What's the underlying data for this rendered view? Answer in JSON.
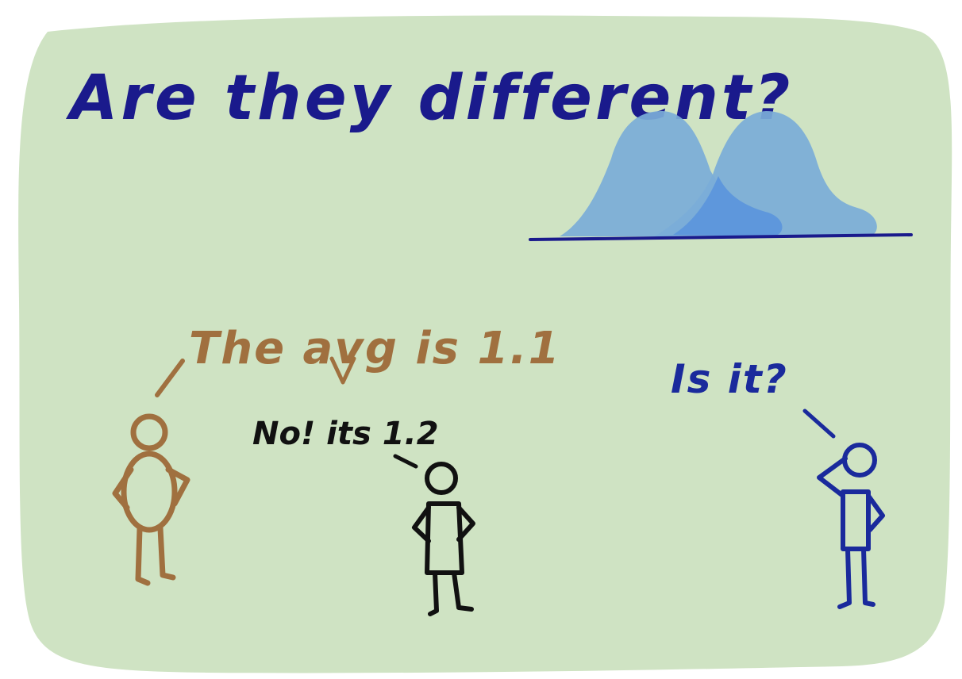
{
  "title": "Are they different?",
  "speech": {
    "brown": "The avg is 1.1",
    "black": "No! its 1.2",
    "blue": "Is it?"
  },
  "colors": {
    "background_panel": "#cfe3c3",
    "title_ink": "#1a1a8c",
    "brown_ink": "#a0703f",
    "black_ink": "#111111",
    "blue_ink": "#1a2a9c",
    "curve_fill": "#7bacd8",
    "curve_overlap": "#5e97dc",
    "baseline": "#1a1a8c"
  },
  "icons": {
    "curves": "two-overlapping-distributions-icon",
    "brown_person": "stick-figure-icon",
    "black_person": "stick-figure-icon",
    "blue_person": "thinking-stick-figure-icon"
  }
}
